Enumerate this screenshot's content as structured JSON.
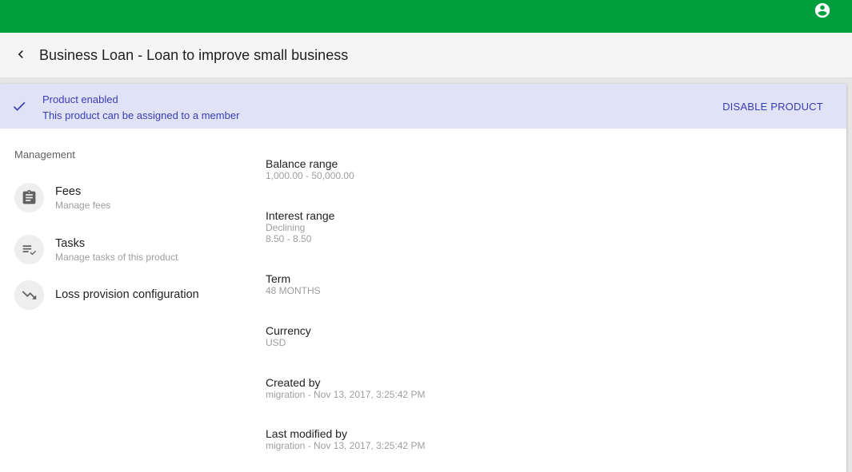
{
  "header": {
    "account_icon": "account-circle-icon"
  },
  "titlebar": {
    "back_icon": "chevron-left-icon",
    "title": "Business Loan - Loan to improve small business"
  },
  "banner": {
    "icon": "check-icon",
    "title": "Product enabled",
    "subtitle": "This product can be assigned to a member",
    "action_label": "DISABLE PRODUCT"
  },
  "management": {
    "title": "Management",
    "items": [
      {
        "label": "Fees",
        "sublabel": "Manage fees",
        "icon": "clipboard-icon"
      },
      {
        "label": "Tasks",
        "sublabel": "Manage tasks of this product",
        "icon": "playlist-check-icon"
      },
      {
        "label": "Loss provision configuration",
        "sublabel": "",
        "icon": "trending-down-icon"
      }
    ]
  },
  "details": {
    "balance_range": {
      "label": "Balance range",
      "value": "1,000.00 - 50,000.00"
    },
    "interest_range": {
      "label": "Interest range",
      "type": "Declining",
      "value": "8.50 - 8.50"
    },
    "term": {
      "label": "Term",
      "value": "48 MONTHS"
    },
    "currency": {
      "label": "Currency",
      "value": "USD"
    },
    "created_by": {
      "label": "Created by",
      "value": "migration - Nov 13, 2017, 3:25:42 PM"
    },
    "last_modified_by": {
      "label": "Last modified by",
      "value": "migration - Nov 13, 2017, 3:25:42 PM"
    }
  },
  "colors": {
    "topbar": "#009e3c",
    "banner_bg": "#e0e2f5",
    "accent": "#3a3db8"
  }
}
